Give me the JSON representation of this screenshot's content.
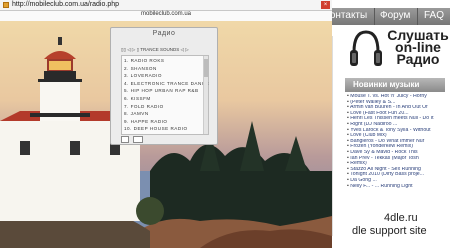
{
  "browser": {
    "url": "http://mobileclub.com.ua/radio.php",
    "close_glyph": "×",
    "site_caption": "mobileclub.com.ua"
  },
  "radio": {
    "title": "Радио",
    "toolbar": "▯▯ ◁ ▷ ▯  TRANCE SOUNDS  ◁ ▷",
    "stations": [
      "1. RADIO ROKS",
      "2. SHANSON",
      "3. LOVERADIO",
      "4. ELECTRONIC TRANCE DANCE",
      "5. HIP HOP URBAN RAP R&B",
      "6. KISSFM",
      "7. FOLD RADIO",
      "8. JAMVN",
      "9. HAPPE RADIO",
      "10. DEEP HOUSE RADIO"
    ]
  },
  "site": {
    "nav": [
      "Контакты",
      "Форум",
      "FAQ"
    ],
    "promo": {
      "line1": "Слушать",
      "line2": "on-line",
      "line3": "Радио"
    },
    "news_title": "Новинки музыки",
    "news_items": [
      "Mouse T. vs. Hot 'n' Juicy - Horny",
      "(Peter Walley & S...",
      "Armin van Buuren - In And Out Of",
      "Love (Fast Foot Fun 20...",
      "Henri Les Thissen meets Null - Do It",
      "Right (DJ Nadiroo ...",
      "Yves Larock & Tony Sylla - Without",
      "Love (Club Mix)",
      "Bangleros - Do What Immer Nur",
      "Frozen (Yonderkew Remix)",
      "Dave Sy & Mavid - Rock This",
      "Ian Prev - Tekkas (Major Tosh",
      "Remix)",
      "Stazzo All Night - Sex Running",
      "Tonight 2010 (Dirty Bass proje...",
      "Da Gong ...",
      "Nelly F... - ... Running Light"
    ],
    "footer_brand": "4dle.ru",
    "footer_tag": "dle support site"
  }
}
